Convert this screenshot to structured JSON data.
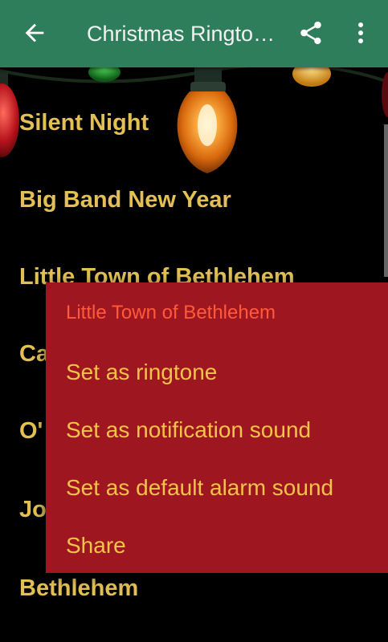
{
  "appbar": {
    "title": "Christmas Ringtones",
    "background": "#2e7d5b",
    "back_icon": "arrow-left-icon",
    "share_icon": "share-icon",
    "more_icon": "more-vert-icon"
  },
  "songs": [
    "Silent Night",
    "Big Band New Year",
    "Little Town of Bethlehem",
    "Ca",
    "O'",
    "Jo",
    "Bethlehem"
  ],
  "menu": {
    "title": "Little Town of Bethlehem",
    "options": [
      "Set as ringtone",
      "Set as notification sound",
      "Set as default alarm sound",
      "Share"
    ],
    "background": "#9e1620",
    "title_color": "#ff5a3c",
    "option_color": "#f3c34a"
  },
  "colors": {
    "song_text": "#e2c055",
    "background": "#000000"
  }
}
